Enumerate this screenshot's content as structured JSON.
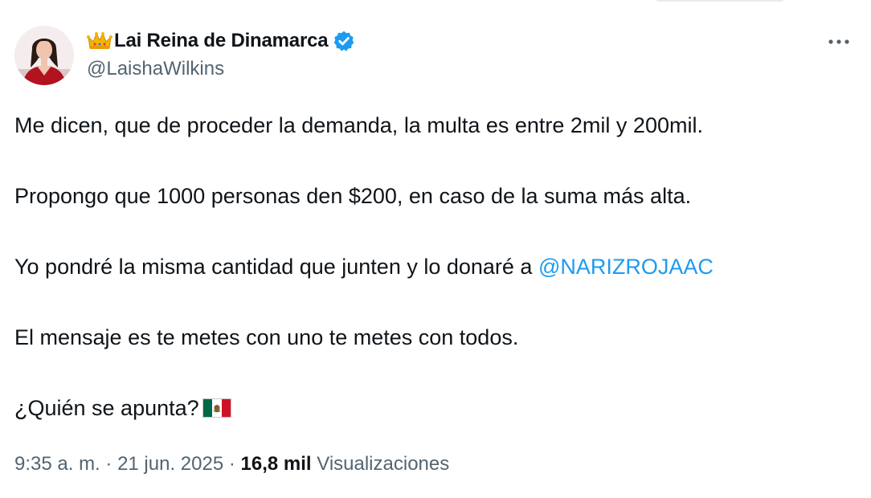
{
  "user": {
    "display_name": "Lai Reina de Dinamarca",
    "handle": "@LaishaWilkins",
    "name_emoji": "crown-icon",
    "verified_icon": "verified-badge-icon",
    "avatar": "profile-photo",
    "more_icon": "more-options-icon"
  },
  "tweet": {
    "p1": "Me dicen, que de proceder la demanda, la multa es entre 2mil y 200mil.",
    "p2": "Propongo que 1000 personas den $200, en caso de la suma más alta.",
    "p3_text": "Yo pondré la misma cantidad que junten y lo donaré a ",
    "p3_mention": "@NARIZROJAAC",
    "p4": "El mensaje es te metes con uno te metes con todos.",
    "p5_text": "¿Quién se apunta?",
    "p5_emoji": "mexico-flag-icon"
  },
  "meta": {
    "time": "9:35 a. m.",
    "separator1": " · ",
    "date": "21 jun. 2025",
    "separator2": " · ",
    "views_count": "16,8 mil",
    "views_label": " Visualizaciones"
  },
  "colors": {
    "link": "#1d9bf0",
    "secondary_text": "#536471",
    "primary_text": "#0f1419",
    "verified": "#1d9bf0"
  }
}
